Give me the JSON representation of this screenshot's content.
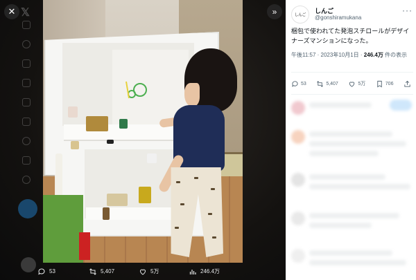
{
  "viewer": {
    "close_icon": "close-icon",
    "close_glyph": "✕",
    "expand_icon": "chevron-right-double-icon",
    "expand_glyph": "»",
    "actions": [
      {
        "icon": "reply-icon",
        "count": "53"
      },
      {
        "icon": "retweet-icon",
        "count": "5,407"
      },
      {
        "icon": "like-icon",
        "count": "5万"
      },
      {
        "icon": "views-icon",
        "count": "246.4万"
      }
    ]
  },
  "tweet": {
    "avatar_text": "しんご",
    "author_name": "しんご",
    "handle": "@gonshiramukana",
    "more_glyph": "···",
    "text": "梱包で使われてた発泡スチロールがデザイナーズマンションになった。",
    "time": "午後11:57 · 2023年10月1日 · ",
    "views_count": "246.4万",
    "views_suffix": " 件の表示",
    "actions": [
      {
        "icon": "reply-icon",
        "count": "53"
      },
      {
        "icon": "retweet-icon",
        "count": "5,407"
      },
      {
        "icon": "like-icon",
        "count": "5万"
      },
      {
        "icon": "bookmark-icon",
        "count": "706"
      },
      {
        "icon": "share-icon",
        "count": ""
      }
    ]
  },
  "colors": {
    "viewer_bg": "#0b0b0b",
    "panel_bg": "#ffffff",
    "text_primary": "#0f1419",
    "text_secondary": "#536471",
    "shirt": "#1f2d57",
    "floor": "#b88652",
    "mat": "#5f9d3c"
  }
}
